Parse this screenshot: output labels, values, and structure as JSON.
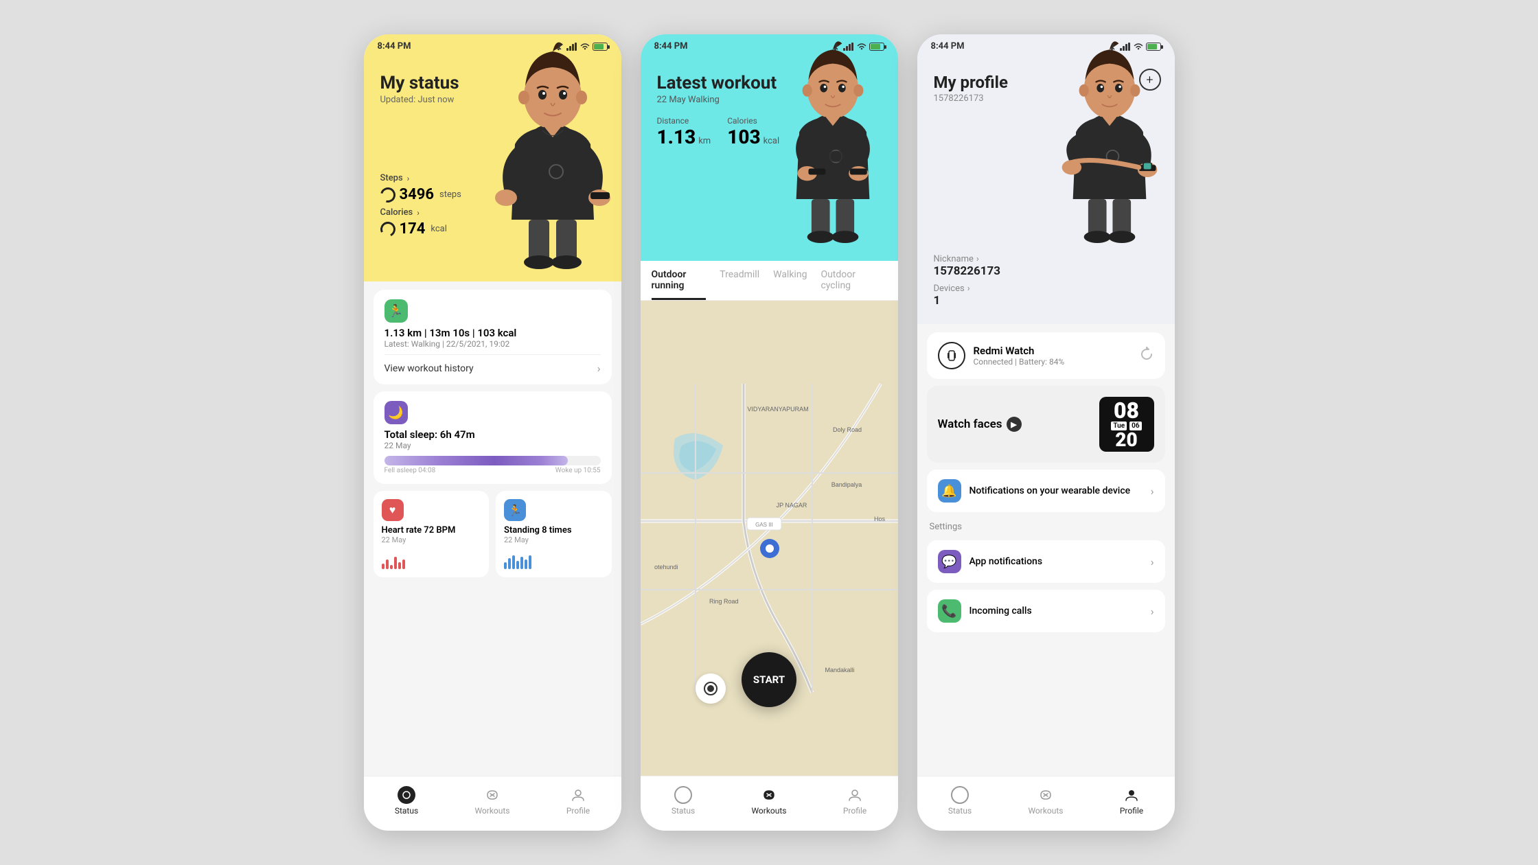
{
  "phone1": {
    "statusBar": {
      "time": "8:44 PM"
    },
    "header": {
      "title": "My status",
      "subtitle": "Updated: Just now"
    },
    "steps": {
      "label": "Steps",
      "value": "3496",
      "unit": "steps"
    },
    "calories": {
      "label": "Calories",
      "value": "174",
      "unit": "kcal"
    },
    "workout": {
      "summary": "1.13 km | 13m 10s | 103 kcal",
      "latest": "Latest: Walking | 22/5/2021, 19:02",
      "historyLabel": "View workout history"
    },
    "sleep": {
      "title": "Total sleep: 6h 47m",
      "date": "22 May",
      "fellAsleep": "Fell asleep 04:08",
      "wokeUp": "Woke up 10:55"
    },
    "heartRate": {
      "title": "Heart rate 72 BPM",
      "date": "22 May"
    },
    "standing": {
      "title": "Standing 8 times",
      "date": "22 May"
    },
    "nav": {
      "status": "Status",
      "workouts": "Workouts",
      "profile": "Profile",
      "active": "status"
    }
  },
  "phone2": {
    "statusBar": {
      "time": "8:44 PM"
    },
    "header": {
      "title": "Latest workout",
      "subtitle": "22 May Walking"
    },
    "distance": {
      "label": "Distance",
      "value": "1.13",
      "unit": "km"
    },
    "calories": {
      "label": "Calories",
      "value": "103",
      "unit": "kcal"
    },
    "tabs": [
      {
        "label": "Outdoor running",
        "active": true
      },
      {
        "label": "Treadmill",
        "active": false
      },
      {
        "label": "Walking",
        "active": false
      },
      {
        "label": "Outdoor cycling",
        "active": false
      }
    ],
    "mapLabels": [
      "VIDYARANYAPURAM",
      "JP NAGAR",
      "Bandipalya",
      "Ring Road",
      "Mandakalli",
      "Hos",
      "otehundi",
      "Doly Road"
    ],
    "startButton": "START",
    "nav": {
      "status": "Status",
      "workouts": "Workouts",
      "profile": "Profile",
      "active": "workouts"
    }
  },
  "phone3": {
    "statusBar": {
      "time": "8:44 PM"
    },
    "header": {
      "title": "My profile",
      "uid": "1578226173"
    },
    "nickname": {
      "label": "Nickname",
      "value": "1578226173"
    },
    "devices": {
      "label": "Devices",
      "count": "1"
    },
    "device": {
      "name": "Redmi Watch",
      "status": "Connected | Battery: 84%"
    },
    "watchFaces": {
      "label": "Watch faces",
      "arrow": "▶",
      "hour": "08",
      "dateDay": "Tue",
      "dateNum": "06",
      "dayBig": "20"
    },
    "notifications": {
      "label": "Notifications on your wearable device"
    },
    "settings": {
      "label": "Settings",
      "appNotifications": "App notifications",
      "incomingCalls": "Incoming calls"
    },
    "nav": {
      "status": "Status",
      "workouts": "Workouts",
      "profile": "Profile",
      "active": "profile"
    }
  }
}
